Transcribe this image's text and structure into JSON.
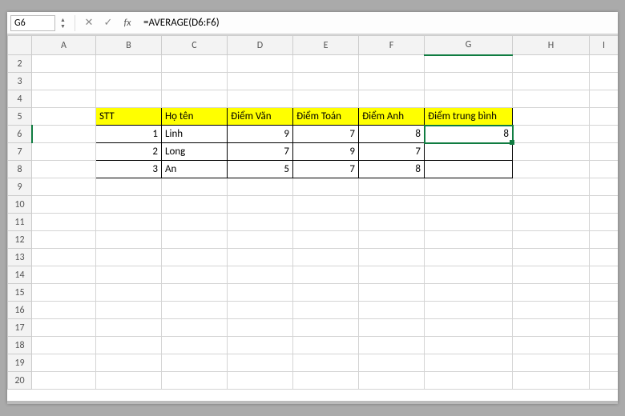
{
  "formula_bar": {
    "active_cell": "G6",
    "cancel_icon": "✕",
    "confirm_icon": "✓",
    "fx_label": "fx",
    "formula": "=AVERAGE(D6:F6)"
  },
  "columns": [
    "A",
    "B",
    "C",
    "D",
    "E",
    "F",
    "G",
    "H",
    "I"
  ],
  "row_start": 2,
  "row_end": 20,
  "table_header": {
    "stt": "STT",
    "hoten": "Họ tên",
    "van": "Điểm Văn",
    "toan": "Điểm Toán",
    "anh": "Điểm Anh",
    "tb": "Điểm trung bình"
  },
  "rows": [
    {
      "stt": "1",
      "hoten": "Linh",
      "van": "9",
      "toan": "7",
      "anh": "8",
      "tb": "8"
    },
    {
      "stt": "2",
      "hoten": "Long",
      "van": "7",
      "toan": "9",
      "anh": "7",
      "tb": ""
    },
    {
      "stt": "3",
      "hoten": "An",
      "van": "5",
      "toan": "7",
      "anh": "8",
      "tb": ""
    }
  ],
  "chart_data": {
    "type": "table",
    "title": "",
    "columns": [
      "STT",
      "Họ tên",
      "Điểm Văn",
      "Điểm Toán",
      "Điểm Anh",
      "Điểm trung bình"
    ],
    "records": [
      [
        1,
        "Linh",
        9,
        7,
        8,
        8
      ],
      [
        2,
        "Long",
        7,
        9,
        7,
        null
      ],
      [
        3,
        "An",
        5,
        7,
        8,
        null
      ]
    ]
  }
}
